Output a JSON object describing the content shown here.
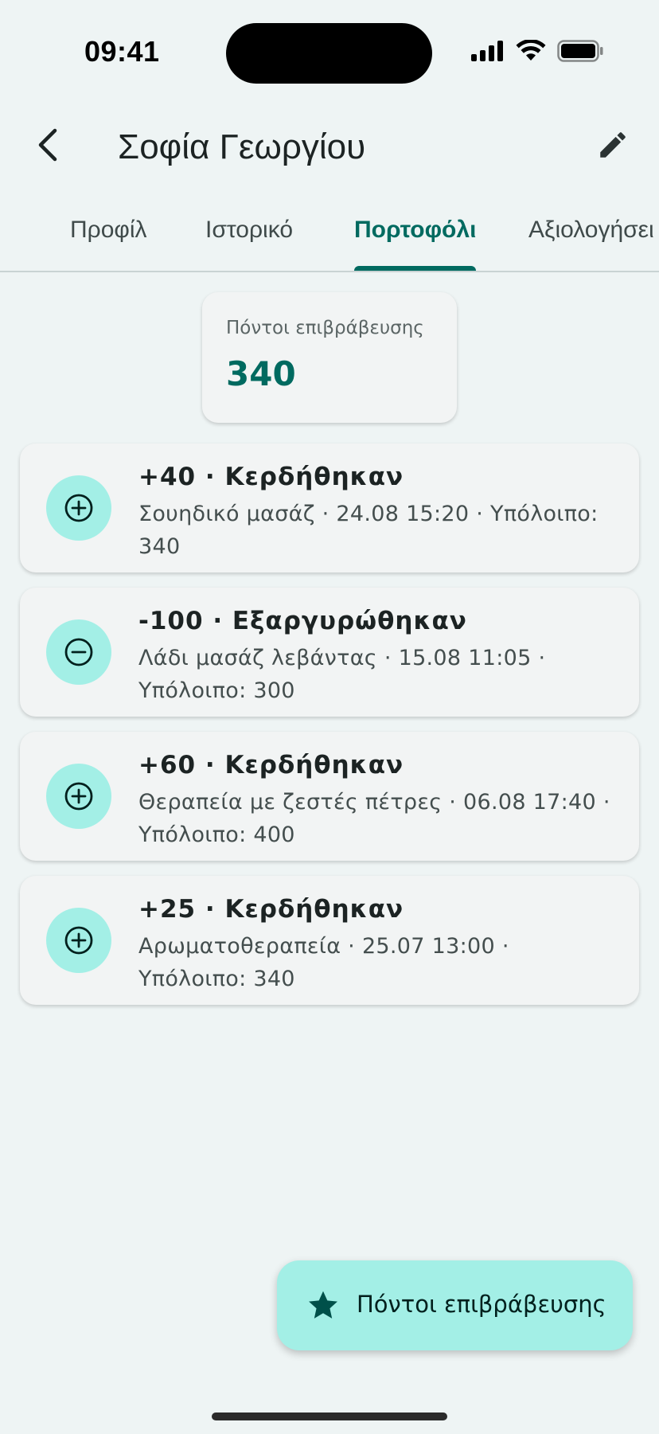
{
  "status_bar": {
    "time": "09:41"
  },
  "app_bar": {
    "title": "Σοφία Γεωργίου",
    "back_icon": "arrow-back-icon",
    "edit_icon": "pencil-icon"
  },
  "tabs": [
    {
      "label": "Προφίλ",
      "active": false
    },
    {
      "label": "Ιστορικό",
      "active": false
    },
    {
      "label": "Πορτοφόλι",
      "active": true
    },
    {
      "label": "Αξιολογήσει",
      "active": false
    }
  ],
  "balance": {
    "label": "Πόντοι επιβράβευσης",
    "value": "340"
  },
  "transactions": [
    {
      "type": "earned",
      "icon": "add-circle-icon",
      "title": "+40 · Κερδήθηκαν",
      "description": "Σουηδικό μασάζ · 24.08 15:20 · Υπόλοιπο: 340"
    },
    {
      "type": "redeemed",
      "icon": "remove-circle-icon",
      "title": "-100 · Εξαργυρώθηκαν",
      "description": "Λάδι μασάζ λεβάντας · 15.08 11:05 · Υπόλοιπο: 300"
    },
    {
      "type": "earned",
      "icon": "add-circle-icon",
      "title": "+60 · Κερδήθηκαν",
      "description": "Θεραπεία με ζεστές πέτρες · 06.08 17:40 · Υπόλοιπο: 400"
    },
    {
      "type": "earned",
      "icon": "add-circle-icon",
      "title": "+25 · Κερδήθηκαν",
      "description": "Αρωματοθεραπεία · 25.07 13:00 · Υπόλοιπο: 340"
    }
  ],
  "fab": {
    "label": "Πόντοι επιβράβευσης",
    "icon": "star-icon"
  },
  "colors": {
    "primary": "#006a60",
    "tertiary_container": "#a3efe6",
    "background": "#eef4f4",
    "surface": "#f2f4f4"
  }
}
